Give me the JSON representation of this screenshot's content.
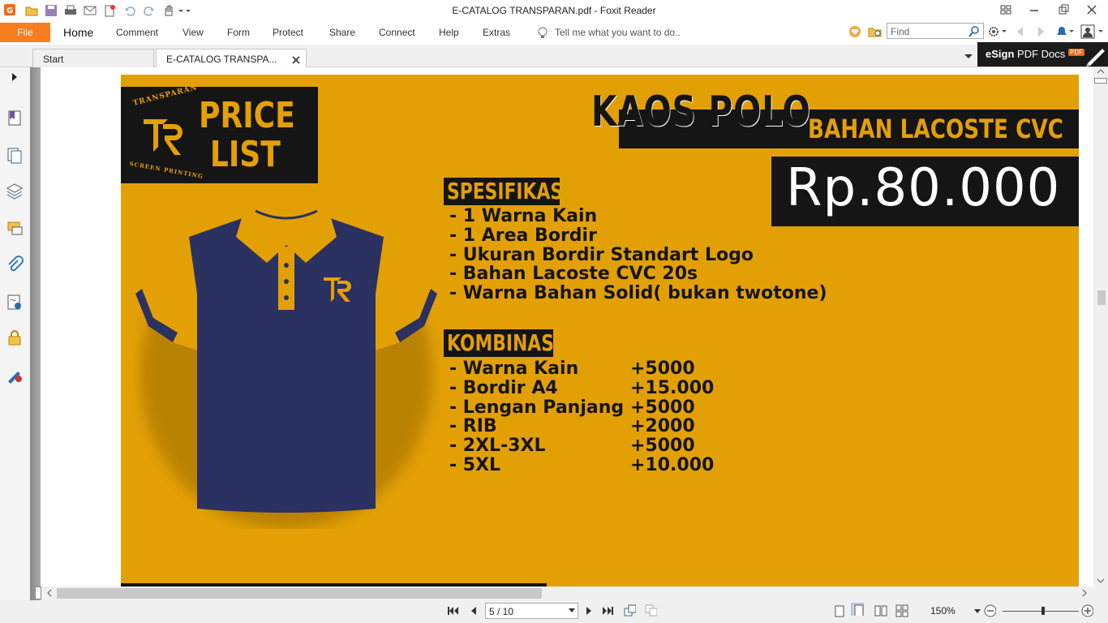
{
  "window": {
    "title": "E-CATALOG TRANSPARAN.pdf - Foxit Reader"
  },
  "ribbon": {
    "file_label": "File",
    "tabs": [
      "Home",
      "Comment",
      "View",
      "Form",
      "Protect",
      "Share",
      "Connect",
      "Help",
      "Extras"
    ],
    "tell_me_placeholder": "Tell me what you want to do..",
    "find_placeholder": "Find"
  },
  "doc_tabs": [
    {
      "label": "Start"
    },
    {
      "label": "E-CATALOG TRANSPA..."
    }
  ],
  "esign": {
    "bold": "eSign",
    "label": " PDF Docs",
    "badge": "PDF"
  },
  "page": {
    "logo": {
      "brand_top": "TRANSPARAN",
      "brand_bottom": "SCREEN PRINTING",
      "price_list": "PRICE LIST"
    },
    "heading": "KAOS POLO",
    "subheading": "BAHAN LACOSTE CVC",
    "price": "Rp.80.000",
    "spec_title": "SPESIFIKASI",
    "spec_items": [
      "- 1 Warna Kain",
      "- 1 Area Bordir",
      "- Ukuran Bordir Standart Logo",
      "- Bahan Lacoste CVC 20s",
      "- Warna Bahan Solid( bukan twotone)"
    ],
    "combo_title": "KOMBINASI",
    "combo_items": [
      {
        "name": "- Warna Kain",
        "price": "+5000"
      },
      {
        "name": "- Bordir A4",
        "price": "+15.000"
      },
      {
        "name": "- Lengan Panjang",
        "price": "+5000"
      },
      {
        "name": "- RIB",
        "price": "+2000"
      },
      {
        "name": "- 2XL-3XL",
        "price": "+5000"
      },
      {
        "name": "- 5XL",
        "price": "+10.000"
      }
    ],
    "colors": {
      "background": "#e3a005",
      "dark": "#151515",
      "shirt_body": "#2b3160",
      "shirt_accent": "#e3a005"
    }
  },
  "status": {
    "page_indicator": "5 / 10",
    "zoom": "150%"
  }
}
